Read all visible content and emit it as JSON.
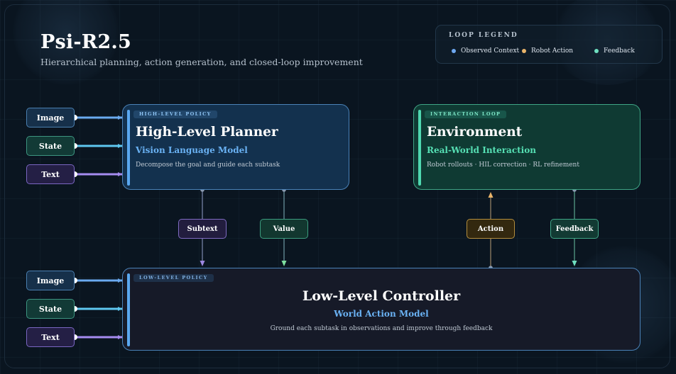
{
  "header": {
    "title": "Psi-R2.5",
    "subtitle": "Hierarchical planning, action generation, and closed-loop improvement"
  },
  "legend": {
    "title": "LOOP LEGEND",
    "items": [
      {
        "label": "Observed Context",
        "color": "#6ea8f0"
      },
      {
        "label": "Robot Action",
        "color": "#e9b46a"
      },
      {
        "label": "Feedback",
        "color": "#6fe0c0"
      }
    ]
  },
  "high_level_inputs": [
    "Image",
    "State",
    "Text"
  ],
  "low_level_inputs": [
    "Image",
    "State",
    "Text"
  ],
  "high_level_panel": {
    "tag": "HIGH-LEVEL POLICY",
    "title": "High-Level Planner",
    "subtitle": "Vision Language Model",
    "description": "Decompose the goal and guide each subtask"
  },
  "environment_panel": {
    "tag": "INTERACTION LOOP",
    "title": "Environment",
    "subtitle": "Real-World Interaction",
    "description": "Robot rollouts · HIL correction · RL refinement"
  },
  "low_level_panel": {
    "tag": "LOW-LEVEL POLICY",
    "title": "Low-Level Controller",
    "subtitle": "World Action Model",
    "description": "Ground each subtask in observations and improve through feedback"
  },
  "edges": {
    "subtext": "Subtext",
    "value": "Value",
    "action": "Action",
    "feedback": "Feedback"
  },
  "colors": {
    "image_wire": "#6aaaf0",
    "state_wire": "#5ec8f0",
    "text_wire": "#a58cf0",
    "planner_accent": "#5aa8f0",
    "environment_accent": "#4fd8b0"
  }
}
